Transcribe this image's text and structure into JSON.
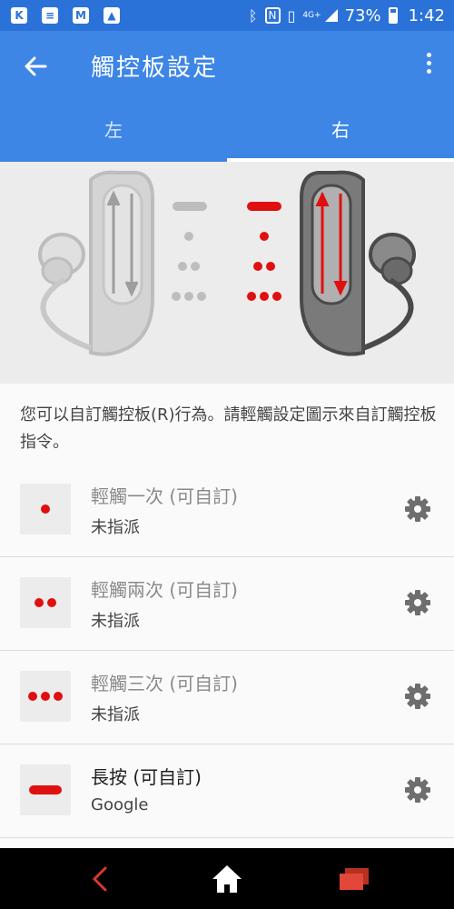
{
  "status_bar": {
    "left_icons": [
      "k-app-icon",
      "news-icon",
      "gmail-icon",
      "image-icon"
    ],
    "left_glyphs": [
      "K",
      "≡",
      "M",
      "▲"
    ],
    "right_icons": [
      "bluetooth-icon",
      "nfc-icon",
      "vibrate-icon",
      "signal-4g-icon"
    ],
    "network": "4G+",
    "battery_text": "73%",
    "battery_level_percent": 73,
    "time": "1:42"
  },
  "app_bar": {
    "title": "觸控板設定"
  },
  "tabs": [
    {
      "label": "左",
      "selected": false
    },
    {
      "label": "右",
      "selected": true
    }
  ],
  "description": "您可以自訂觸控板(R)行為。請輕觸設定圖示來自訂觸控板指令。",
  "items": [
    {
      "title": "輕觸一次 (可自訂)",
      "subtitle": "未指派",
      "icon": "single-tap-icon",
      "enabled": false
    },
    {
      "title": "輕觸兩次 (可自訂)",
      "subtitle": "未指派",
      "icon": "double-tap-icon",
      "enabled": false
    },
    {
      "title": "輕觸三次 (可自訂)",
      "subtitle": "未指派",
      "icon": "triple-tap-icon",
      "enabled": false
    },
    {
      "title": "長按 (可自訂)",
      "subtitle": "Google",
      "icon": "long-press-icon",
      "enabled": true
    }
  ],
  "colors": {
    "app_bar": "#3d86e6",
    "status_bar": "#2b72d8",
    "accent_red": "#e01010",
    "inactive_gray": "#bdbdbd",
    "nav_bar": "#000000"
  }
}
